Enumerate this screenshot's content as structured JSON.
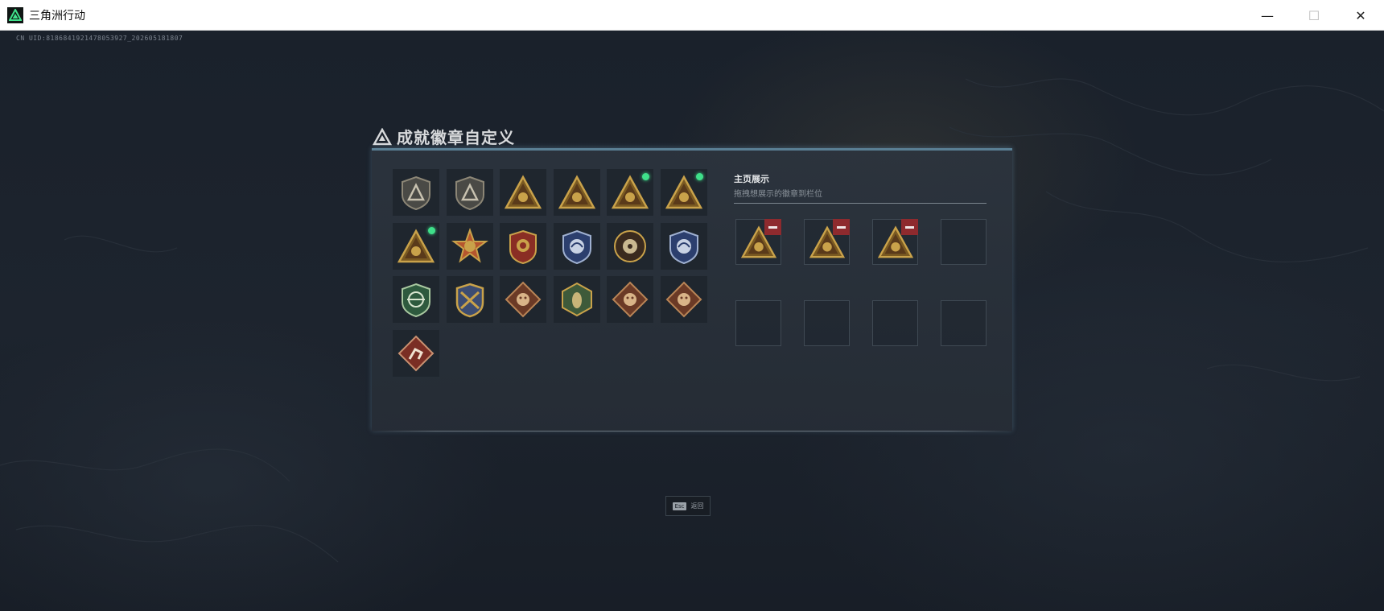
{
  "window": {
    "title": "三角洲行动",
    "minimize_glyph": "—",
    "maximize_glyph": "☐",
    "close_glyph": "✕"
  },
  "uid_text": "CN UID:8186841921478053927_202605181807",
  "dialog": {
    "title": "成就徽章自定义",
    "showcase_title": "主页展示",
    "showcase_subtitle": "拖拽想展示的徽章到栏位"
  },
  "badges": [
    {
      "icon": "delta-triangle-badge-icon",
      "style": "grey-shield",
      "new": false
    },
    {
      "icon": "helicopter-badge-icon",
      "style": "grey-shield",
      "new": false
    },
    {
      "icon": "helmet-badge-icon",
      "style": "gold-triangle",
      "new": false
    },
    {
      "icon": "number-one-badge-icon",
      "style": "gold-triangle",
      "new": false
    },
    {
      "icon": "battery-badge-icon",
      "style": "gold-triangle",
      "new": true
    },
    {
      "icon": "squad-badge-icon",
      "style": "gold-triangle",
      "new": true
    },
    {
      "icon": "team-badge-icon",
      "style": "gold-triangle",
      "new": true
    },
    {
      "icon": "star-medal-badge-icon",
      "style": "star-medal",
      "new": false
    },
    {
      "icon": "eagle-crest-badge-icon",
      "style": "red-crest",
      "new": false
    },
    {
      "icon": "eagle-shield-badge-icon",
      "style": "blue-shield",
      "new": false
    },
    {
      "icon": "skull-target-badge-icon",
      "style": "round-brown",
      "new": false
    },
    {
      "icon": "shark-shield-badge-icon",
      "style": "blue-shield",
      "new": false
    },
    {
      "icon": "green-target-badge-icon",
      "style": "green-shield",
      "new": false
    },
    {
      "icon": "crossed-rifles-badge-icon",
      "style": "gold-crest",
      "new": false
    },
    {
      "icon": "wolf-diamond-badge-icon",
      "style": "brown-diamond",
      "new": false
    },
    {
      "icon": "hornet-hexagon-badge-icon",
      "style": "green-hexagon",
      "new": false
    },
    {
      "icon": "dragon-diamond-badge-icon",
      "style": "brown-diamond",
      "new": false
    },
    {
      "icon": "dragon-diamond-2-badge-icon",
      "style": "brown-diamond",
      "new": false
    },
    {
      "icon": "runner-diamond-badge-icon",
      "style": "red-diamond",
      "new": false
    }
  ],
  "slots": [
    {
      "badge": "squad-badge-icon",
      "removable": true
    },
    {
      "badge": "battery-badge-icon",
      "removable": true
    },
    {
      "badge": "team-badge-icon",
      "removable": true
    },
    {
      "badge": null,
      "removable": false
    },
    {
      "badge": null,
      "removable": false
    },
    {
      "badge": null,
      "removable": false
    },
    {
      "badge": null,
      "removable": false
    },
    {
      "badge": null,
      "removable": false
    }
  ],
  "esc_hint": {
    "key": "Esc",
    "label": "返回"
  },
  "colors": {
    "accent_green": "#3fe08a",
    "remove_red": "#8e2a2e",
    "gold": "#c9a24a",
    "dialog_border": "#5a7f94"
  }
}
